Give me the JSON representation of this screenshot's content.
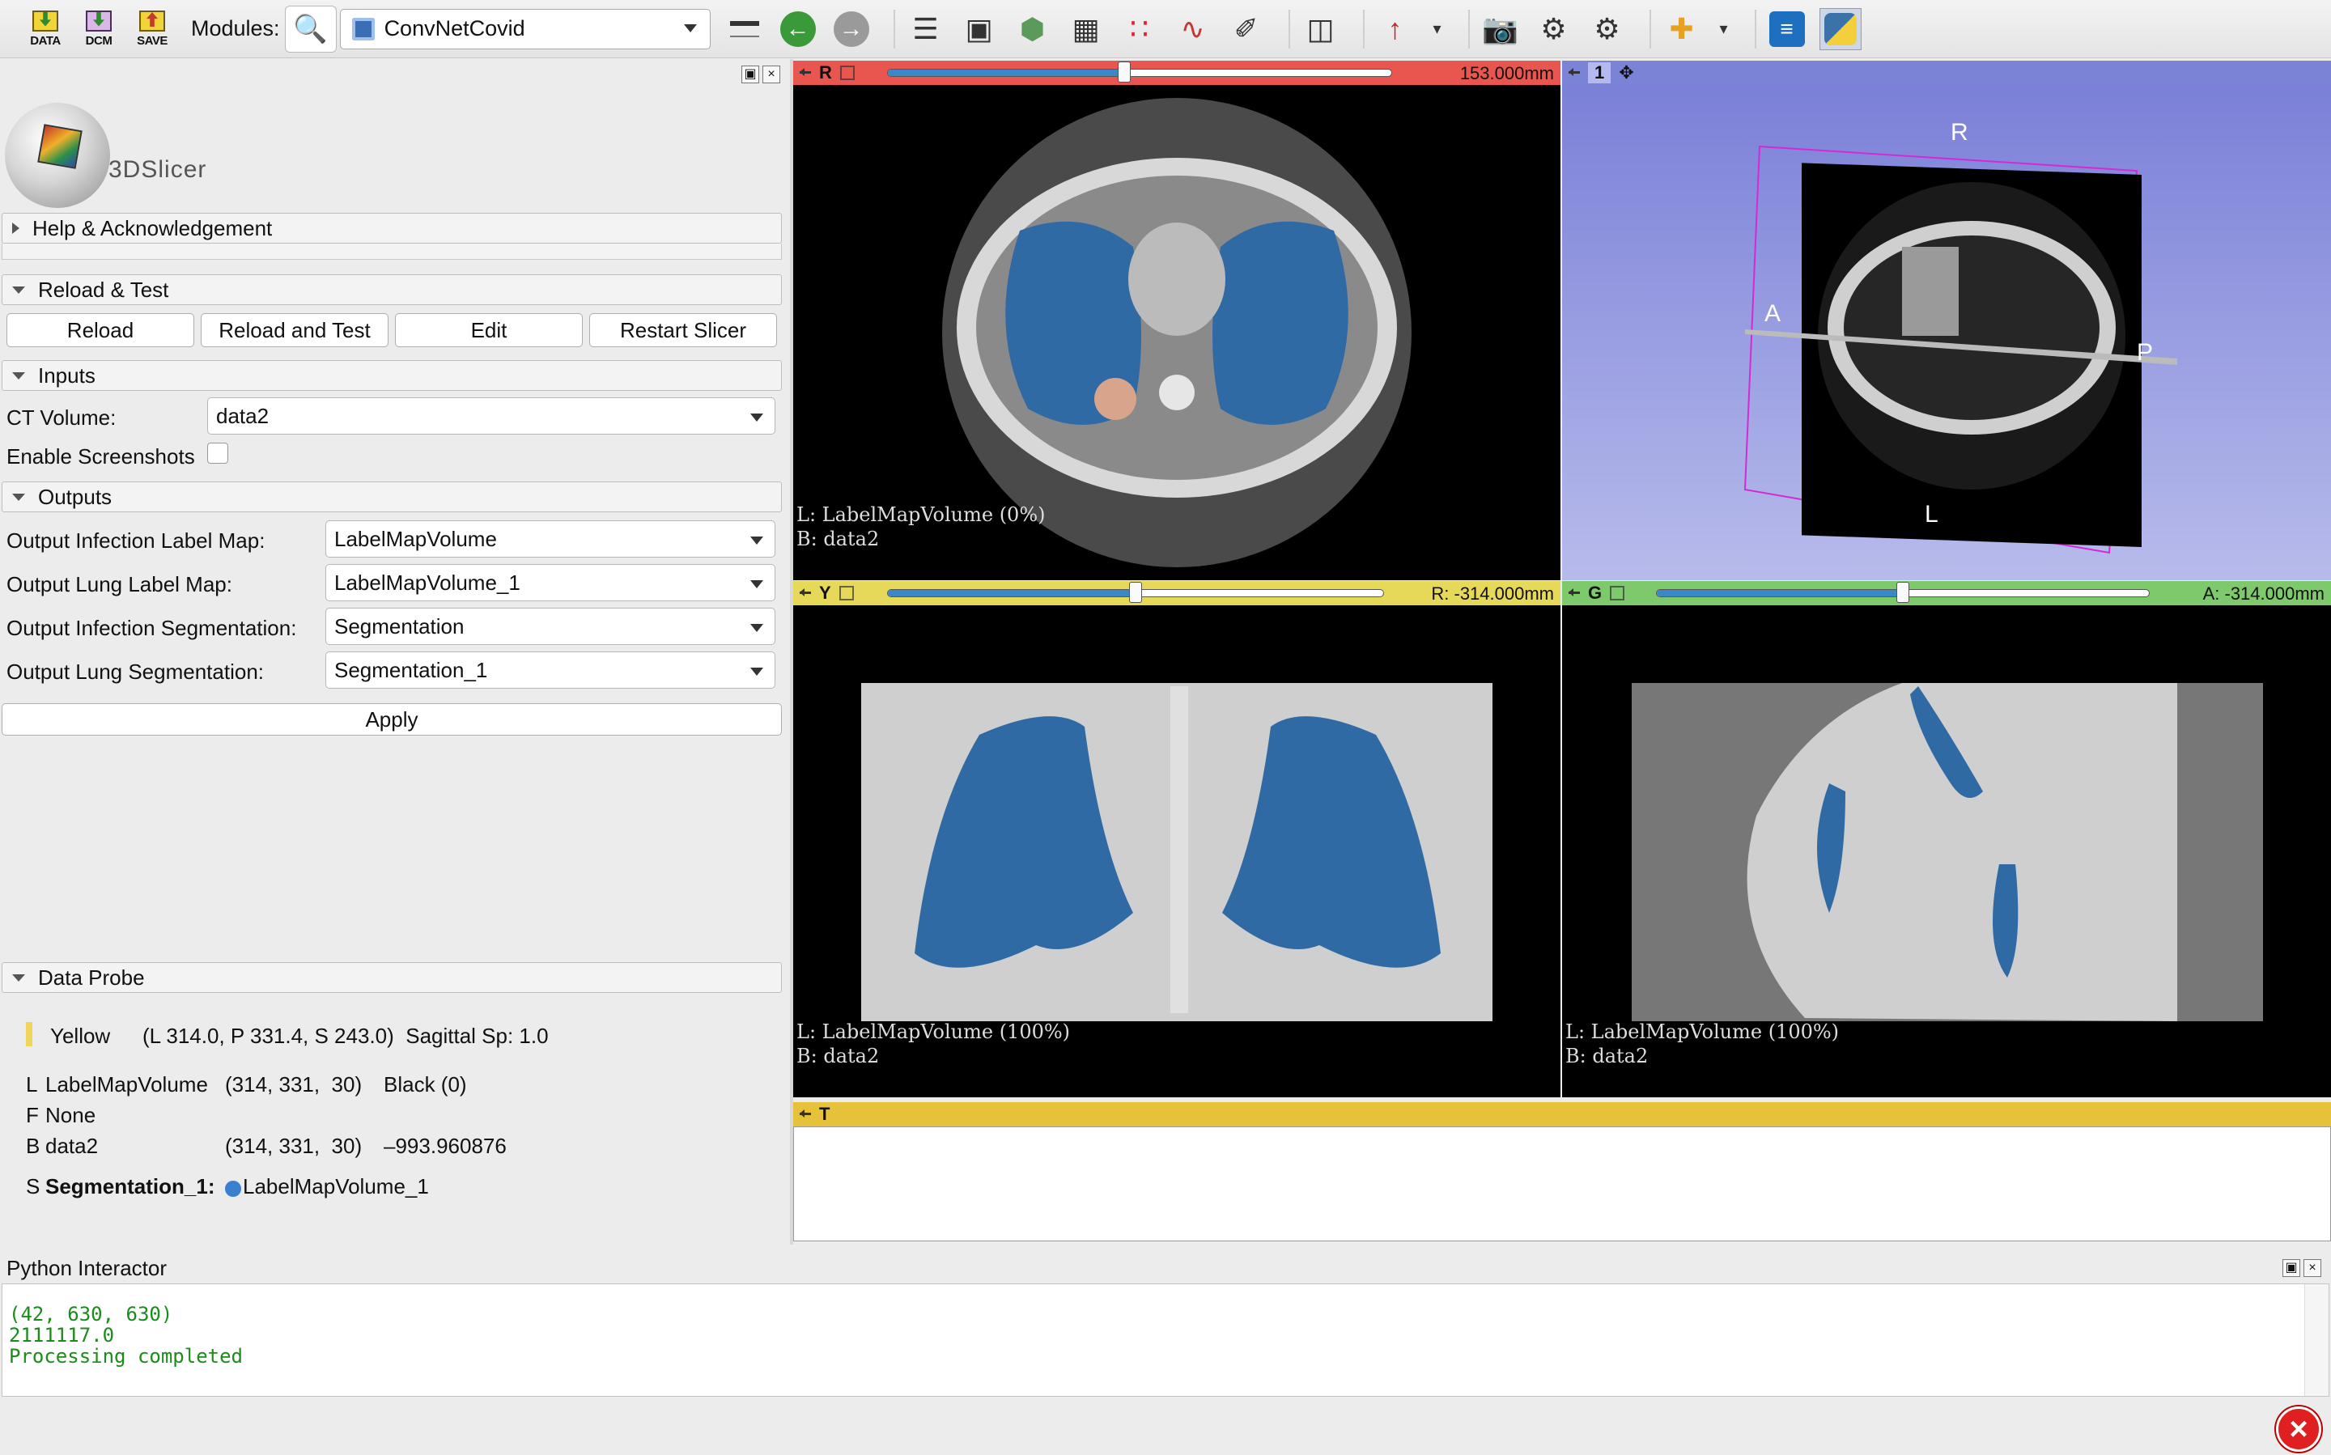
{
  "toolbar": {
    "io_buttons": [
      {
        "label": "DATA"
      },
      {
        "label": "DCM"
      },
      {
        "label": "SAVE"
      }
    ],
    "modules_label": "Modules:",
    "module_selected": "ConvNetCovid"
  },
  "panel": {
    "logo_text": "3DSlicer",
    "help_section": "Help & Acknowledgement",
    "reload_section": "Reload & Test",
    "reload_buttons": [
      "Reload",
      "Reload and Test",
      "Edit",
      "Restart Slicer"
    ],
    "inputs_section": "Inputs",
    "ct_volume_label": "CT Volume:",
    "ct_volume_value": "data2",
    "screenshots_label": "Enable Screenshots",
    "screenshots_checked": false,
    "outputs_section": "Outputs",
    "outputs": [
      {
        "label": "Output Infection Label Map:",
        "value": "LabelMapVolume"
      },
      {
        "label": "Output Lung Label Map:",
        "value": "LabelMapVolume_1"
      },
      {
        "label": "Output Infection Segmentation:",
        "value": "Segmentation"
      },
      {
        "label": "Output Lung Segmentation:",
        "value": "Segmentation_1"
      }
    ],
    "apply_label": "Apply",
    "data_probe_section": "Data Probe",
    "probe": {
      "view_name": "Yellow",
      "coords": "(L 314.0, P 331.4, S 243.0)  Sagittal Sp: 1.0",
      "l_prefix": "L",
      "l_name": "LabelMapVolume",
      "l_ijk": "(314, 331,  30)",
      "l_value": "Black (0)",
      "f_prefix": "F",
      "f_value": "None",
      "b_prefix": "B",
      "b_name": "data2",
      "b_ijk": "(314, 331,  30)",
      "b_value": "–993.960876",
      "s_prefix": "S",
      "s_name": "Segmentation_1:",
      "s_value": "LabelMapVolume_1"
    }
  },
  "views": {
    "red": {
      "letter": "R",
      "offset": "153.000mm",
      "slider_fraction": 0.47,
      "color": "#e8564f",
      "overlay_l": "L: LabelMapVolume (0%)",
      "overlay_b": "B: data2"
    },
    "threed": {
      "letter": "1",
      "labels": {
        "R": "R",
        "A": "A",
        "P": "P",
        "L": "L"
      }
    },
    "yellow": {
      "letter": "Y",
      "offset": "R: -314.000mm",
      "slider_fraction": 0.5,
      "color": "#e6d95a",
      "overlay_l": "L: LabelMapVolume (100%)",
      "overlay_b": "B: data2"
    },
    "green": {
      "letter": "G",
      "offset": "A: -314.000mm",
      "slider_fraction": 0.5,
      "color": "#7ec96b",
      "overlay_l": "L: LabelMapVolume (100%)",
      "overlay_b": "B: data2"
    },
    "table": {
      "letter": "T",
      "color": "#e6c23a"
    }
  },
  "python": {
    "title": "Python Interactor",
    "lines": [
      "(42, 630, 630)",
      "2111117.0",
      "Processing completed"
    ]
  }
}
